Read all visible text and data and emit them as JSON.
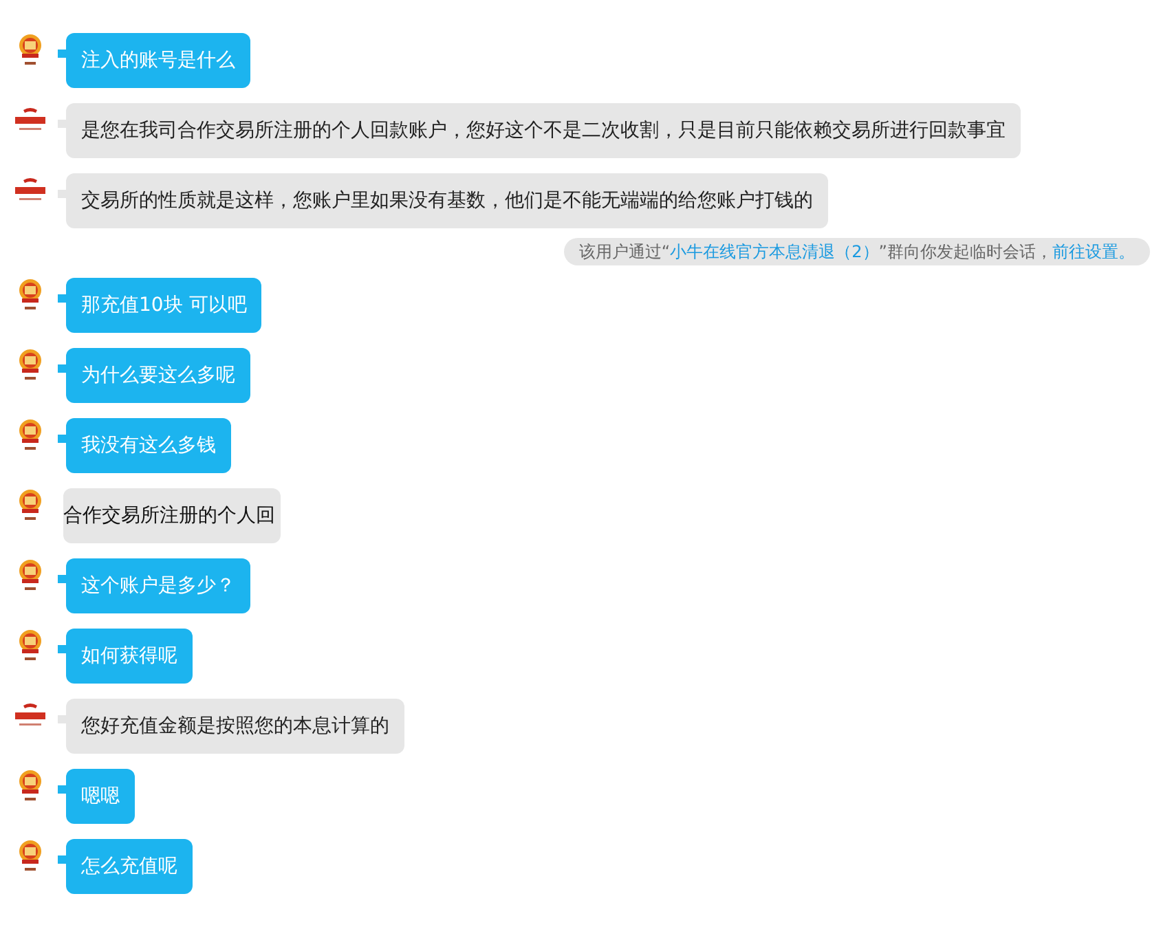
{
  "messages": [
    {
      "kind": "sent",
      "text": "注入的账号是什么"
    },
    {
      "kind": "received",
      "text": "是您在我司合作交易所注册的个人回款账户，您好这个不是二次收割，只是目前只能依赖交易所进行回款事宜"
    },
    {
      "kind": "received",
      "text": "交易所的性质就是这样，您账户里如果没有基数，他们是不能无端端的给您账户打钱的"
    },
    {
      "kind": "notice",
      "parts": [
        {
          "kind": "text",
          "text": "该用户通过“"
        },
        {
          "kind": "link",
          "text": "小牛在线官方本息清退（2）"
        },
        {
          "kind": "text",
          "text": "”群向你发起临时会话，"
        },
        {
          "kind": "link",
          "text": "前往设置。"
        }
      ]
    },
    {
      "kind": "sent",
      "text": "那充值10块 可以吧"
    },
    {
      "kind": "sent",
      "text": "为什么要这么多呢"
    },
    {
      "kind": "sent",
      "text": "我没有这么多钱"
    },
    {
      "kind": "sent",
      "quoted": true,
      "text": "合作交易所注册的个人回"
    },
    {
      "kind": "sent",
      "text": "这个账户是多少？"
    },
    {
      "kind": "sent",
      "text": "如何获得呢"
    },
    {
      "kind": "received",
      "text": "您好充值金额是按照您的本息计算的"
    },
    {
      "kind": "sent",
      "text": "嗯嗯"
    },
    {
      "kind": "sent",
      "text": "怎么充值呢"
    }
  ]
}
